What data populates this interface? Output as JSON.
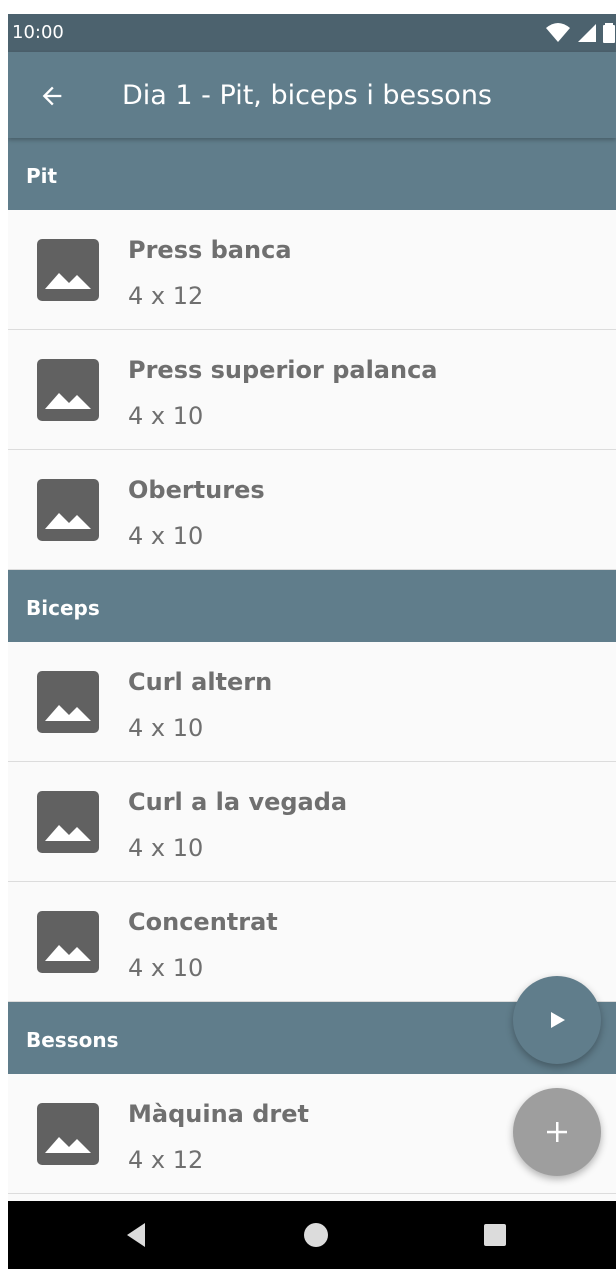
{
  "status_bar": {
    "time": "10:00"
  },
  "app_bar": {
    "title": "Dia 1 - Pit, biceps i bessons",
    "back_icon": "arrow-left-icon"
  },
  "sections": [
    {
      "label": "Pit",
      "exercises": [
        {
          "name": "Press banca",
          "sets": "4 x 12"
        },
        {
          "name": "Press superior palanca",
          "sets": "4 x 10"
        },
        {
          "name": "Obertures",
          "sets": "4 x 10"
        }
      ]
    },
    {
      "label": "Biceps",
      "exercises": [
        {
          "name": "Curl altern",
          "sets": "4 x 10"
        },
        {
          "name": "Curl a la vegada",
          "sets": "4 x 10"
        },
        {
          "name": "Concentrat",
          "sets": "4 x 10"
        }
      ]
    },
    {
      "label": "Bessons",
      "exercises": [
        {
          "name": "Màquina dret",
          "sets": "4 x 12"
        }
      ]
    }
  ],
  "fabs": {
    "play_icon": "play-icon",
    "add_icon": "plus-icon"
  },
  "nav": {
    "back_icon": "nav-back-icon",
    "home_icon": "nav-home-icon",
    "recents_icon": "nav-recents-icon"
  },
  "colors": {
    "primary": "#607d8b",
    "status_bar": "#4c626e",
    "text_muted": "#6f6f6f",
    "fab_secondary": "#9e9e9e"
  }
}
